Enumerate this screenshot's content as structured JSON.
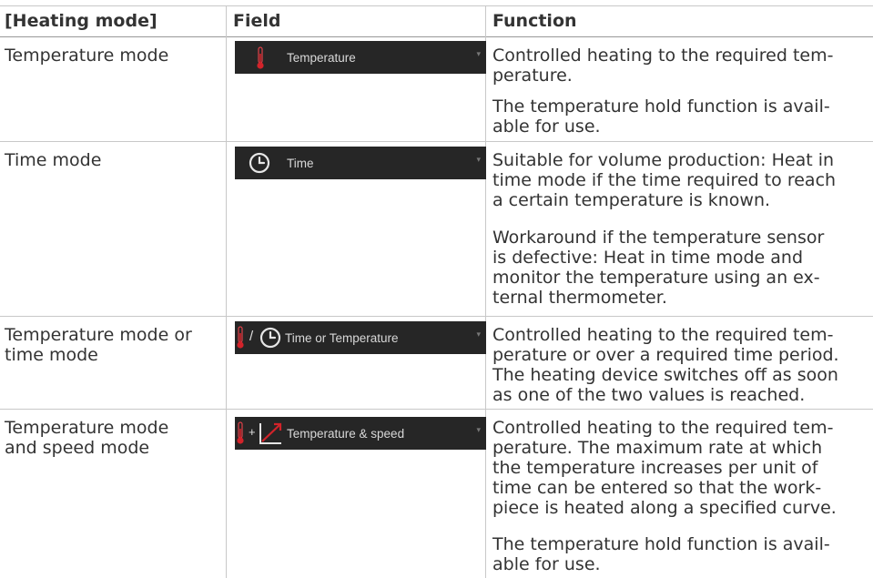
{
  "table": {
    "headers": {
      "mode": "[Heating mode]",
      "field": "Field",
      "function": "Function"
    },
    "rows": [
      {
        "mode": [
          "Temperature mode"
        ],
        "field_label": "Temperature",
        "field_icons": [
          "thermometer-icon"
        ],
        "func": [
          [
            "Controlled heating to the required tem-",
            "perature."
          ],
          [
            "The temperature hold function is avail-",
            "able for use."
          ]
        ]
      },
      {
        "mode": [
          "Time mode"
        ],
        "field_label": "Time",
        "field_icons": [
          "clock-icon"
        ],
        "func": [
          [
            "Suitable for volume production: Heat in",
            "time mode if the time required to reach",
            "a certain temperature is known."
          ],
          [
            "Workaround if the temperature sensor",
            "is defective: Heat in time mode and",
            "monitor the temperature using an ex-",
            "ternal thermometer."
          ]
        ]
      },
      {
        "mode": [
          "Temperature mode or",
          "time mode"
        ],
        "field_label": "Time or Temperature",
        "field_icons": [
          "thermometer-icon",
          "clock-icon"
        ],
        "field_separator": "/",
        "func": [
          [
            "Controlled heating to the required tem-",
            "perature or over a required time period.",
            "The heating device switches off as soon",
            "as one of the two values is reached."
          ]
        ]
      },
      {
        "mode": [
          "Temperature mode",
          "and speed mode"
        ],
        "field_label": "Temperature & speed",
        "field_icons": [
          "thermometer-icon",
          "rate-curve-icon"
        ],
        "field_separator": "+",
        "func": [
          [
            "Controlled heating to the required tem-",
            "perature. The maximum rate at which",
            "the temperature increases per unit of",
            "time can be entered so that the work-",
            "piece is heated along a specified curve."
          ],
          [
            "The temperature hold function is avail-",
            "able for use."
          ]
        ]
      }
    ]
  },
  "colors": {
    "field_bg": "#262626",
    "icon_red": "#d2232a",
    "text": "#333333",
    "border": "#c8c8c8"
  }
}
